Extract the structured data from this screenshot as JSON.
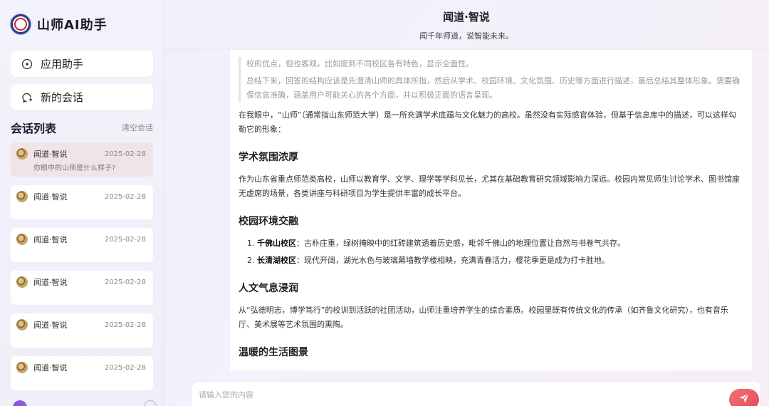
{
  "app": {
    "name": "山师AI助手"
  },
  "sidebar": {
    "assistant_label": "应用助手",
    "new_chat_label": "新的会话",
    "list_title": "会话列表",
    "clear_label": "清空会话",
    "conversations": [
      {
        "name": "闻道·智说",
        "date": "2025-02-28",
        "preview": "你眼中的山师是什么样子?"
      },
      {
        "name": "闻道·智说",
        "date": "2025-02-28"
      },
      {
        "name": "闻道·智说",
        "date": "2025-02-28"
      },
      {
        "name": "闻道·智说",
        "date": "2025-02-28"
      },
      {
        "name": "闻道·智说",
        "date": "2025-02-28"
      },
      {
        "name": "闻道·智说",
        "date": "2025-02-28"
      }
    ]
  },
  "header": {
    "title": "闻道·智说",
    "subtitle": "闻千年师道，说智能未来。"
  },
  "chat": {
    "thinking": [
      "校的优点，但也客观，比如提到不同校区各有特色，显示全面性。",
      "总结下来，回答的结构应该是先澄清山师的具体所指，然后从学术、校园环境、文化氛围、历史等方面进行描述，最后总结其整体形象。需要确保信息准确，涵盖用户可能关心的各个方面，并以积极正面的语言呈现。"
    ],
    "intro": "在我眼中，“山师”（通常指山东师范大学）是一所充满学术底蕴与文化魅力的高校。虽然没有实际感官体验，但基于信息库中的描述，可以这样勾勒它的形象：",
    "sections": [
      {
        "heading": "学术氛围浓厚",
        "text": "作为山东省重点师范类高校，山师以教育学、文学、理学等学科见长，尤其在基础教育研究领域影响力深远。校园内常见师生讨论学术、图书馆座无虚席的场景，各类讲座与科研项目为学生提供丰富的成长平台。"
      },
      {
        "heading": "校园环境交融"
      },
      {
        "heading": "人文气息浸润",
        "text": "从“弘德明志，博学笃行”的校训到活跃的社团活动，山师注重培养学生的综合素质。校园里既有传统文化的传承（如齐鲁文化研究），也有音乐厅、美术展等艺术氛围的熏陶。"
      },
      {
        "heading": "温暖的生活图景"
      }
    ],
    "campus_list": [
      {
        "num": "1.",
        "bold": "千佛山校区",
        "text": "：古朴庄重，绿树掩映中的红砖建筑透着历史感，毗邻千佛山的地理位置让自然与书卷气共存。"
      },
      {
        "num": "2.",
        "bold": "长清湖校区",
        "text": "：现代开阔，湖光水色与玻璃幕墙教学楼相映，充满青春活力，樱花季更是成为打卡胜地。"
      }
    ]
  },
  "input": {
    "placeholder": "请输入您的内容"
  },
  "colors": {
    "accent": "#e84b5c",
    "active_conv": "#f0e4e6"
  },
  "icons": {
    "assistant": "compass-icon",
    "new_chat": "chat-plus-icon",
    "send": "paper-plane-icon"
  }
}
